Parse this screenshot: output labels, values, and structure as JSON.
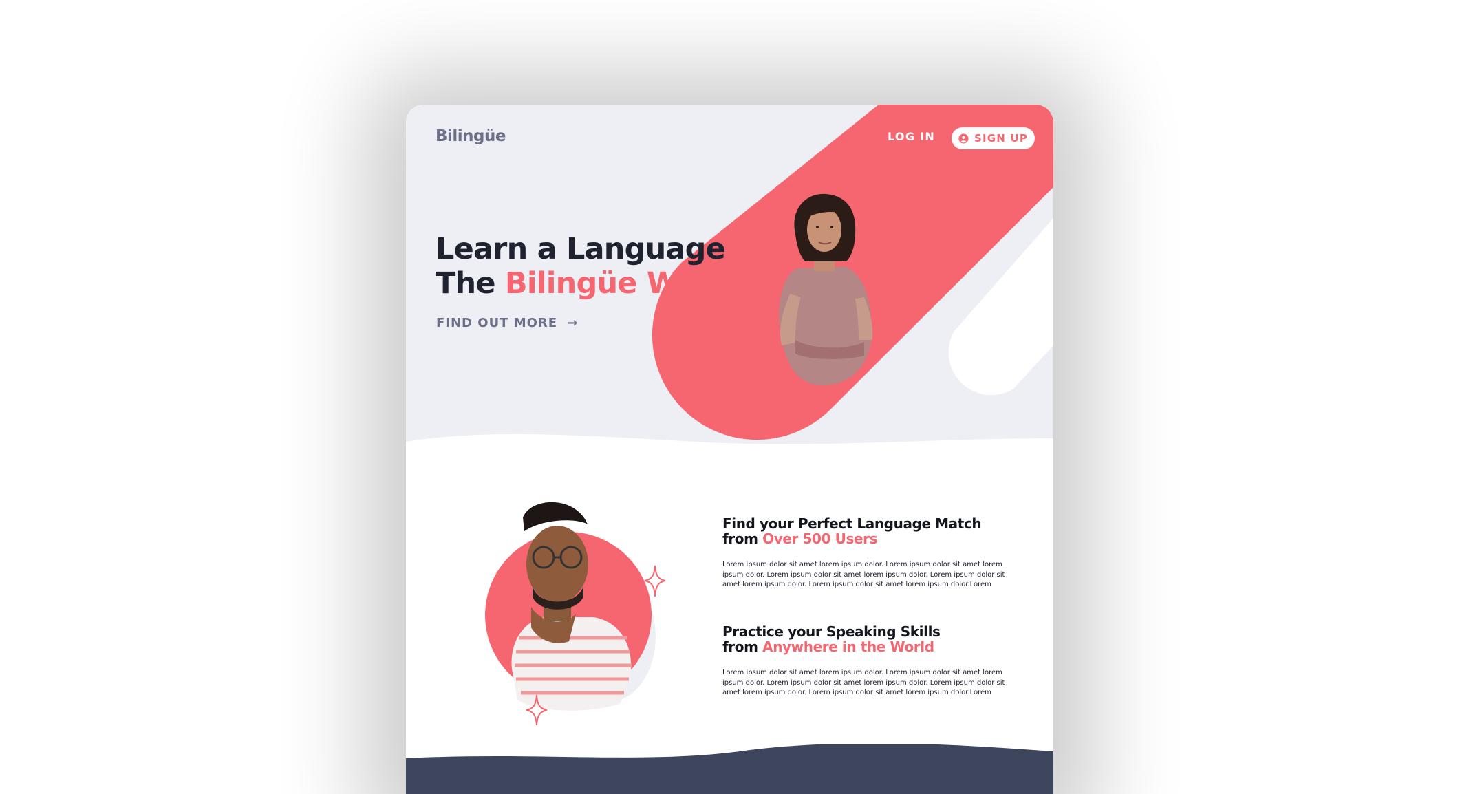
{
  "header": {
    "logo": "Bilingüe",
    "login_label": "LOG IN",
    "signup_label": "SIGN UP"
  },
  "hero": {
    "title_line1": "Learn a Language",
    "title_line2_prefix": "The ",
    "title_line2_accent": "Bilingüe Way",
    "cta_label": "FIND OUT MORE",
    "cta_arrow": "→"
  },
  "features": [
    {
      "title_line1": "Find your Perfect Language Match",
      "title_line2_prefix": "from ",
      "title_line2_accent": "Over 500 Users",
      "body": "Lorem ipsum dolor sit amet lorem ipsum dolor. Lorem ipsum dolor sit amet lorem ipsum dolor. Lorem ipsum dolor sit amet lorem ipsum dolor. Lorem ipsum dolor sit amet lorem ipsum dolor. Lorem ipsum dolor sit amet lorem ipsum dolor.Lorem"
    },
    {
      "title_line1": "Practice your Speaking Skills",
      "title_line2_prefix": "from ",
      "title_line2_accent": "Anywhere in the World",
      "body": "Lorem ipsum dolor sit amet lorem ipsum dolor. Lorem ipsum dolor sit amet lorem ipsum dolor. Lorem ipsum dolor sit amet lorem ipsum dolor. Lorem ipsum dolor sit amet lorem ipsum dolor. Lorem ipsum dolor sit amet lorem ipsum dolor.Lorem"
    }
  ],
  "colors": {
    "accent": "#f56670",
    "hero_bg": "#eeeff4",
    "footer": "#3e465e",
    "heading": "#1f2330",
    "muted": "#6b7088"
  },
  "icons": [
    "user-icon",
    "arrow-right-icon",
    "sparkle-icon"
  ]
}
